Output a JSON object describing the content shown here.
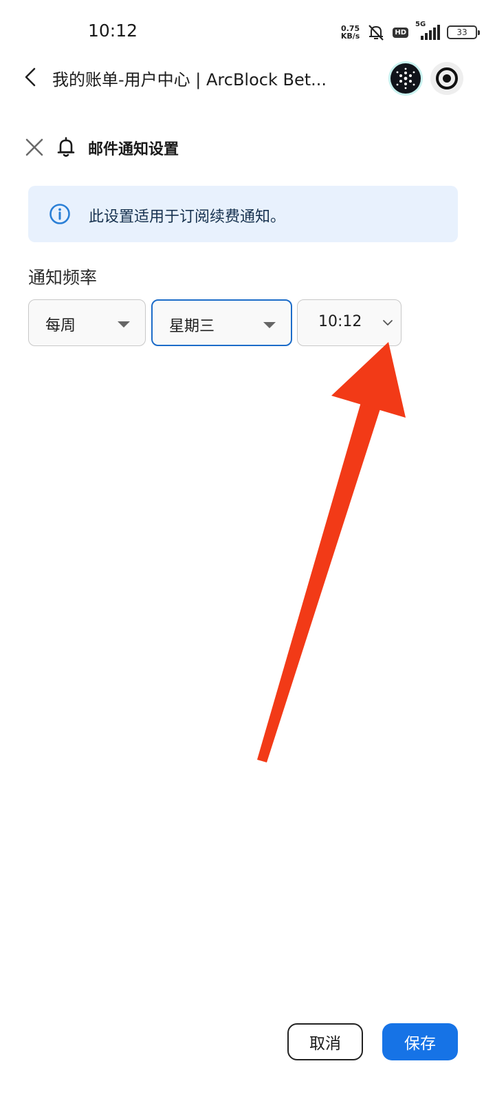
{
  "status_bar": {
    "time": "10:12",
    "net_speed_value": "0.75",
    "net_speed_unit": "KB/s",
    "hd_badge": "HD",
    "network_type": "5G",
    "battery": "33"
  },
  "header": {
    "title": "我的账单-用户中心 | ArcBlock Bet..."
  },
  "dialog": {
    "title": "邮件通知设置",
    "info_text": "此设置适用于订阅续费通知。",
    "frequency_label": "通知频率",
    "frequency_value": "每周",
    "day_value": "星期三",
    "time_value": "10:12"
  },
  "footer": {
    "cancel_label": "取消",
    "save_label": "保存"
  },
  "colors": {
    "primary": "#1673e6",
    "info_bg": "#e8f1fd",
    "annotation_arrow": "#f23a17"
  },
  "icons": [
    "back-arrow-icon",
    "app-logo-icon",
    "record-icon",
    "close-icon",
    "bell-icon",
    "info-icon",
    "chevron-down-icon",
    "dropdown-caret-icon"
  ]
}
